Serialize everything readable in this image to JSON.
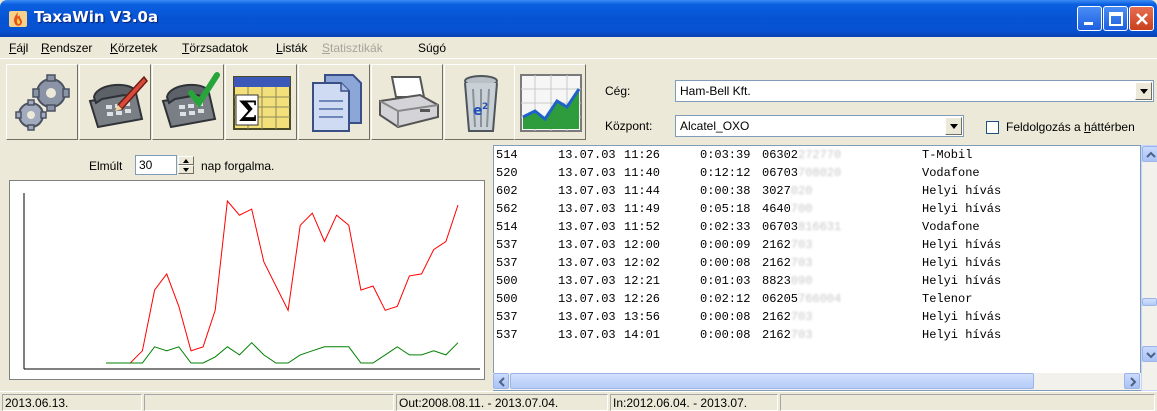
{
  "window": {
    "title": "TaxaWin V3.0a",
    "icon": "flame-app-icon",
    "title_bar_color": "#0654d4"
  },
  "menu": {
    "items": [
      {
        "label": "Fájl",
        "ul": "F",
        "rest": "ájl",
        "enabled": true
      },
      {
        "label": "Rendszer",
        "ul": "R",
        "rest": "endszer",
        "enabled": true
      },
      {
        "label": "Körzetek",
        "ul": "K",
        "rest": "örzetek",
        "enabled": true
      },
      {
        "label": "Törzsadatok",
        "ul": "T",
        "rest": "örzsadatok",
        "enabled": true
      },
      {
        "label": "Listák",
        "ul": "L",
        "rest": "isták",
        "enabled": true
      },
      {
        "label": "Statisztikák",
        "ul": "S",
        "rest": "tatisztikák",
        "enabled": false
      },
      {
        "label": "Súgó",
        "ul": "",
        "rest": "Súgó",
        "enabled": true
      }
    ]
  },
  "toolbar": {
    "buttons": [
      {
        "name": "settings-gears",
        "icon": "gears-icon"
      },
      {
        "name": "phone-edit",
        "icon": "phone-pencil-icon"
      },
      {
        "name": "phone-check",
        "icon": "phone-check-icon"
      },
      {
        "name": "sum-calendar",
        "icon": "sum-calendar-icon"
      },
      {
        "name": "documents",
        "icon": "documents-icon"
      },
      {
        "name": "printer",
        "icon": "printer-icon"
      },
      {
        "name": "recycle-bin",
        "icon": "recycle-bin-icon"
      },
      {
        "name": "statistics-chart",
        "icon": "chart-icon"
      }
    ],
    "company_label": "Cég:",
    "company_value": "Ham-Bell Kft.",
    "exchange_label": "Központ:",
    "exchange_value": "Alcatel_OXO",
    "background_label_ul": "h",
    "background_label_pre": "Feldolgozás a ",
    "background_label_post": "áttérben",
    "background_checked": false
  },
  "period": {
    "prefix": "Elmúlt",
    "days": "30",
    "suffix": "nap forgalma."
  },
  "chart_data": {
    "type": "line",
    "x": [
      1,
      2,
      3,
      4,
      5,
      6,
      7,
      8,
      9,
      10,
      11,
      12,
      13,
      14,
      15,
      16,
      17,
      18,
      19,
      20,
      21,
      22,
      23,
      24,
      25,
      26,
      27,
      28,
      29,
      30
    ],
    "series": [
      {
        "color": "#ff0000",
        "values": [
          2,
          2,
          2,
          8,
          38,
          46,
          30,
          8,
          10,
          28,
          82,
          75,
          78,
          52,
          40,
          28,
          70,
          76,
          62,
          75,
          70,
          38,
          40,
          28,
          30,
          45,
          46,
          58,
          62,
          80
        ]
      },
      {
        "color": "#008000",
        "values": [
          2,
          2,
          2,
          2,
          10,
          8,
          10,
          2,
          2,
          5,
          10,
          6,
          12,
          6,
          2,
          2,
          6,
          8,
          10,
          10,
          10,
          2,
          2,
          6,
          10,
          6,
          6,
          8,
          6,
          12
        ]
      }
    ],
    "title": "",
    "xlabel": "",
    "ylabel": ""
  },
  "calls": {
    "rows": [
      {
        "ext": "514",
        "date": "13.07.03",
        "time": "11:26",
        "duration": "0:03:39",
        "number": "06302",
        "hidden": "272770",
        "carrier": "T-Mobil"
      },
      {
        "ext": "520",
        "date": "13.07.03",
        "time": "11:40",
        "duration": "0:12:12",
        "number": "06703",
        "hidden": "708020",
        "carrier": "Vodafone"
      },
      {
        "ext": "602",
        "date": "13.07.03",
        "time": "11:44",
        "duration": "0:00:38",
        "number": "3027",
        "hidden": "020",
        "carrier": "Helyi hívás"
      },
      {
        "ext": "562",
        "date": "13.07.03",
        "time": "11:49",
        "duration": "0:05:18",
        "number": "4640",
        "hidden": "700",
        "carrier": "Helyi hívás"
      },
      {
        "ext": "514",
        "date": "13.07.03",
        "time": "11:52",
        "duration": "0:02:33",
        "number": "06703",
        "hidden": "816631",
        "carrier": "Vodafone"
      },
      {
        "ext": "537",
        "date": "13.07.03",
        "time": "12:00",
        "duration": "0:00:09",
        "number": "2162",
        "hidden": "703",
        "carrier": "Helyi hívás"
      },
      {
        "ext": "537",
        "date": "13.07.03",
        "time": "12:02",
        "duration": "0:00:08",
        "number": "2162",
        "hidden": "703",
        "carrier": "Helyi hívás"
      },
      {
        "ext": "500",
        "date": "13.07.03",
        "time": "12:21",
        "duration": "0:01:03",
        "number": "8823",
        "hidden": "090",
        "carrier": "Helyi hívás"
      },
      {
        "ext": "500",
        "date": "13.07.03",
        "time": "12:26",
        "duration": "0:02:12",
        "number": "06205",
        "hidden": "766004",
        "carrier": "Telenor"
      },
      {
        "ext": "537",
        "date": "13.07.03",
        "time": "13:56",
        "duration": "0:00:08",
        "number": "2162",
        "hidden": "703",
        "carrier": "Helyi hívás"
      },
      {
        "ext": "537",
        "date": "13.07.03",
        "time": "14:01",
        "duration": "0:00:08",
        "number": "2162",
        "hidden": "703",
        "carrier": "Helyi hívás"
      }
    ]
  },
  "statusbar": {
    "date": "2013.06.13.",
    "empty": "",
    "out_range": "Out:2008.08.11. - 2013.07.04.",
    "in_range": "In:2012.06.04. - 2013.07."
  }
}
